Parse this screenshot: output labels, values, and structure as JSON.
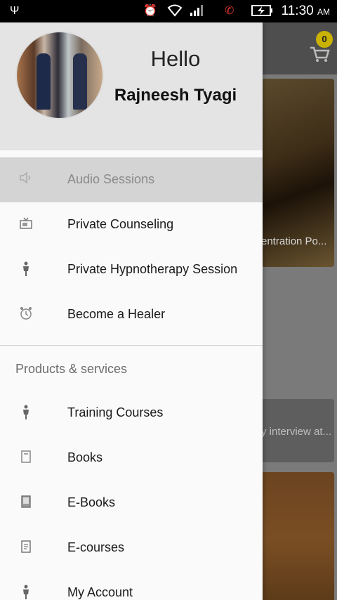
{
  "status_bar": {
    "time": "11:30",
    "ampm": "AM",
    "icons": [
      "usb-icon",
      "alarm-icon",
      "wifi-icon",
      "signal-icon",
      "call-icon",
      "battery-charging-icon"
    ]
  },
  "background": {
    "cart_badge": "0",
    "card1_caption": "entration Po...",
    "card2_caption": "y interview at..."
  },
  "drawer": {
    "greeting": "Hello",
    "user_name": "Rajneesh Tyagi",
    "items": [
      {
        "label": "Audio Sessions",
        "icon": "speaker-icon",
        "active": true
      },
      {
        "label": "Private Counseling",
        "icon": "tv-icon"
      },
      {
        "label": "Private Hypnotherapy Session",
        "icon": "person-icon"
      },
      {
        "label": "Become a Healer",
        "icon": "alarm-clock-icon"
      }
    ],
    "section_title": "Products & services",
    "products": [
      {
        "label": "Training Courses",
        "icon": "person-icon"
      },
      {
        "label": "Books",
        "icon": "book-icon"
      },
      {
        "label": "E-Books",
        "icon": "ebook-icon"
      },
      {
        "label": "E-courses",
        "icon": "document-icon"
      },
      {
        "label": "My Account",
        "icon": "person-icon"
      }
    ]
  }
}
